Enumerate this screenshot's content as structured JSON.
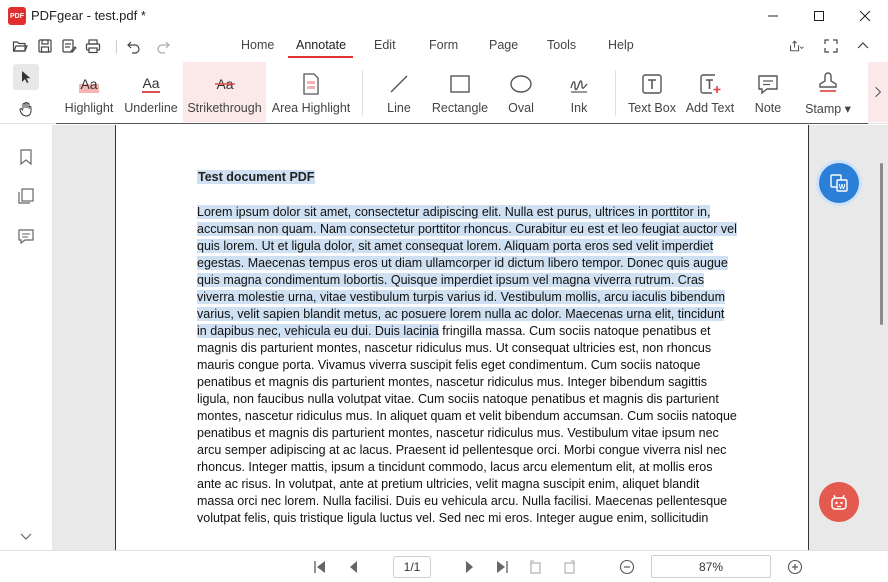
{
  "window": {
    "app_logo_text": "PDF",
    "title": "PDFgear - test.pdf *"
  },
  "menu": {
    "tabs": [
      "Home",
      "Annotate",
      "Edit",
      "Form",
      "Page",
      "Tools",
      "Help"
    ],
    "active_tab": "Annotate"
  },
  "ribbon": {
    "tools": [
      {
        "label": "Highlight",
        "icon": "highlight-icon"
      },
      {
        "label": "Underline",
        "icon": "underline-icon"
      },
      {
        "label": "Strikethrough",
        "icon": "strikethrough-icon"
      },
      {
        "label": "Area Highlight",
        "icon": "area-highlight-icon"
      },
      {
        "label": "Line",
        "icon": "line-icon"
      },
      {
        "label": "Rectangle",
        "icon": "rectangle-icon"
      },
      {
        "label": "Oval",
        "icon": "oval-icon"
      },
      {
        "label": "Ink",
        "icon": "ink-icon"
      },
      {
        "label": "Text Box",
        "icon": "text-box-icon"
      },
      {
        "label": "Add Text",
        "icon": "add-text-icon"
      },
      {
        "label": "Note",
        "icon": "note-icon"
      },
      {
        "label": "Stamp ▾",
        "icon": "stamp-icon"
      }
    ],
    "active_tool": "Strikethrough"
  },
  "document": {
    "title": "Test document PDF",
    "highlighted_text": "Lorem ipsum dolor sit amet, consectetur adipiscing elit. Nulla est purus, ultrices in porttitor in, accumsan non quam. Nam consectetur porttitor rhoncus. Curabitur eu est et leo feugiat auctor vel quis lorem. Ut et ligula dolor, sit amet consequat lorem. Aliquam porta eros sed velit imperdiet egestas. Maecenas tempus eros ut diam ullamcorper id dictum libero tempor. Donec quis augue quis magna condimentum lobortis. Quisque imperdiet ipsum vel magna viverra rutrum. Cras viverra molestie urna, vitae vestibulum turpis varius id. Vestibulum mollis, arcu iaculis bibendum varius, velit sapien blandit metus, ac posuere lorem nulla ac dolor. Maecenas urna elit, tincidunt in dapibus nec, vehicula eu dui. Duis lacinia",
    "body_text": " fringilla massa. Cum sociis natoque penatibus et magnis dis parturient montes, nascetur ridiculus mus. Ut consequat ultricies est, non rhoncus mauris congue porta. Vivamus viverra suscipit felis eget condimentum. Cum sociis natoque penatibus et magnis dis parturient montes, nascetur ridiculus mus. Integer bibendum sagittis ligula, non faucibus nulla volutpat vitae. Cum sociis natoque penatibus et magnis dis parturient montes, nascetur ridiculus mus. In aliquet quam et velit bibendum accumsan. Cum sociis natoque penatibus et magnis dis parturient montes, nascetur ridiculus mus. Vestibulum vitae ipsum nec arcu semper adipiscing at ac lacus. Praesent id pellentesque orci. Morbi congue viverra nisl nec rhoncus. Integer mattis, ipsum a tincidunt commodo, lacus arcu elementum elit, at mollis eros ante ac risus. In volutpat, ante at pretium ultricies, velit magna suscipit enim, aliquet blandit massa orci nec lorem. Nulla facilisi. Duis eu vehicula arcu. Nulla facilisi. Maecenas pellentesque volutpat felis, quis tristique ligula luctus vel. Sed nec mi eros. Integer augue enim, sollicitudin"
  },
  "status": {
    "page_display": "1/1",
    "zoom": "87%"
  },
  "colors": {
    "accent": "#d33333",
    "highlight": "#cfe0f2",
    "convert_button": "#2b7fd6",
    "ai_button": "#e45a4f"
  }
}
